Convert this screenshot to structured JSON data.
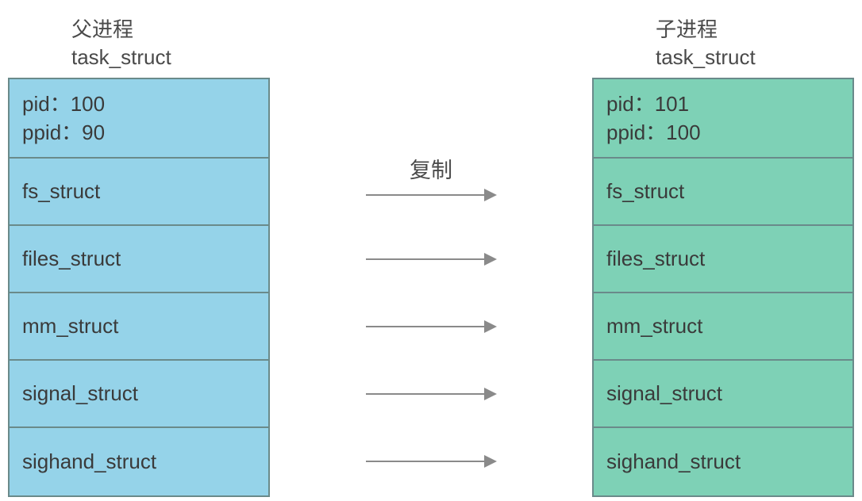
{
  "parent": {
    "title_line1": "父进程",
    "title_line2": "task_struct",
    "pid_line": "pid：100",
    "ppid_line": "ppid：90",
    "fields": [
      "fs_struct",
      "files_struct",
      "mm_struct",
      "signal_struct",
      "sighand_struct"
    ]
  },
  "child": {
    "title_line1": "子进程",
    "title_line2": "task_struct",
    "pid_line": "pid：101",
    "ppid_line": "ppid：100",
    "fields": [
      "fs_struct",
      "files_struct",
      "mm_struct",
      "signal_struct",
      "sighand_struct"
    ]
  },
  "copy_label": "复制"
}
